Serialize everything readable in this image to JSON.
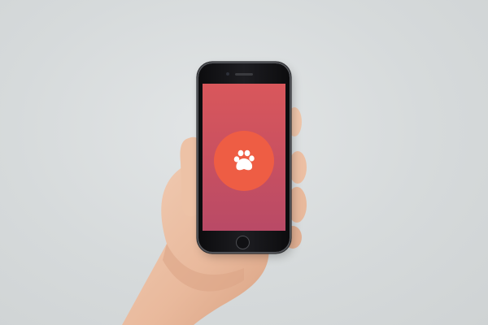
{
  "scene": {
    "background_color": "#d9dcdd",
    "skin_color": "#eec3a8"
  },
  "phone": {
    "frame_color": "#111114",
    "screen_gradient": [
      "#d9575b",
      "#b94a66"
    ]
  },
  "app": {
    "logo_circle_color": "#ee5d44",
    "logo_icon": "paw-icon",
    "logo_icon_color": "#ffffff"
  }
}
